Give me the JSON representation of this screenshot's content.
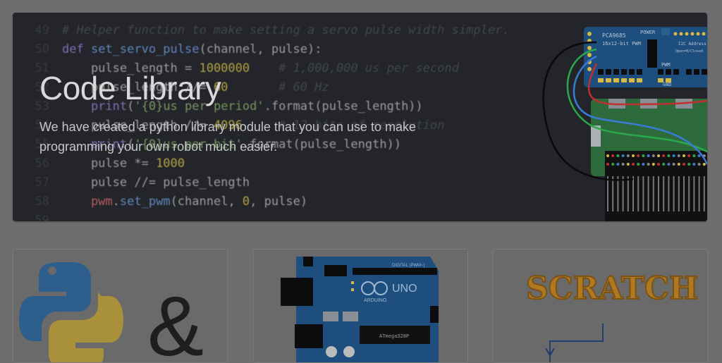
{
  "hero": {
    "title": "Code Library",
    "subtitle": "We have created a python library module that you can use to make programming your own robot much easier."
  },
  "code_lines": [
    {
      "num": "49",
      "parts": [
        {
          "c": "tok-c",
          "t": "# Helper function to make setting a servo pulse width simpler."
        }
      ]
    },
    {
      "num": "50",
      "parts": [
        {
          "c": "tok-k",
          "t": "def "
        },
        {
          "c": "tok-f",
          "t": "set_servo_pulse"
        },
        {
          "c": "tok-p",
          "t": "(channel, pulse):"
        }
      ]
    },
    {
      "num": "51",
      "parts": [
        {
          "c": "tok-p",
          "t": "    pulse_length = "
        },
        {
          "c": "tok-n",
          "t": "1000000"
        },
        {
          "c": "tok-c",
          "t": "    # 1,000,000 us per second"
        }
      ]
    },
    {
      "num": "52",
      "parts": [
        {
          "c": "tok-p",
          "t": "    pulse_length //= "
        },
        {
          "c": "tok-n",
          "t": "60"
        },
        {
          "c": "tok-c",
          "t": "       # 60 Hz"
        }
      ]
    },
    {
      "num": "53",
      "parts": [
        {
          "c": "tok-k",
          "t": "    print"
        },
        {
          "c": "tok-p",
          "t": "("
        },
        {
          "c": "tok-s",
          "t": "'{0}us per period'"
        },
        {
          "c": "tok-p",
          "t": ".format(pulse_length))"
        }
      ]
    },
    {
      "num": "54",
      "parts": [
        {
          "c": "tok-p",
          "t": "    pulse_length //= "
        },
        {
          "c": "tok-n",
          "t": "4096"
        },
        {
          "c": "tok-c",
          "t": "     # 12 bits of resolution"
        }
      ]
    },
    {
      "num": "55",
      "parts": [
        {
          "c": "tok-k",
          "t": "    print"
        },
        {
          "c": "tok-p",
          "t": "("
        },
        {
          "c": "tok-s",
          "t": "'{0}us per bit'"
        },
        {
          "c": "tok-p",
          "t": ".format(pulse_length))"
        }
      ]
    },
    {
      "num": "56",
      "parts": [
        {
          "c": "tok-p",
          "t": "    pulse *= "
        },
        {
          "c": "tok-n",
          "t": "1000"
        }
      ]
    },
    {
      "num": "57",
      "parts": [
        {
          "c": "tok-p",
          "t": "    pulse //= pulse_length"
        }
      ]
    },
    {
      "num": "58",
      "parts": [
        {
          "c": "tok-r",
          "t": "    pwm"
        },
        {
          "c": "tok-p",
          "t": "."
        },
        {
          "c": "tok-f",
          "t": "set_pwm"
        },
        {
          "c": "tok-p",
          "t": "(channel, "
        },
        {
          "c": "tok-n",
          "t": "0"
        },
        {
          "c": "tok-p",
          "t": ", pulse)"
        }
      ]
    },
    {
      "num": "59",
      "parts": []
    }
  ],
  "board": {
    "chip_label": "PCA9685",
    "chip_sub": "16x12-bit PWM",
    "power_label": "POWER",
    "pwm_label": "PWM",
    "gnd_label": "GND",
    "addr_label": "I2C Address",
    "addr_sub": "Open=0/Closed"
  },
  "cards": {
    "python_amp": "&",
    "arduino_uno": "UNO",
    "arduino_brand": "ARDUINO",
    "arduino_chip": "ATmega328P",
    "arduino_digital": "DIGITAL (PWM~)",
    "scratch_logo": "SCRATCH"
  },
  "colors": {
    "page_bg": "#6e6e6e",
    "hero_bg": "#23252b",
    "board_blue": "#1d4e7d",
    "pi_green": "#2e6b3c"
  }
}
